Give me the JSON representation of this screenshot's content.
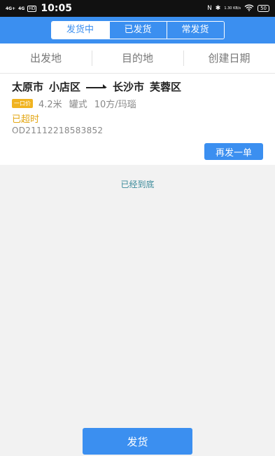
{
  "status_bar": {
    "signal1": "4G+",
    "signal2": "4G",
    "hd": "HD",
    "time": "10:05",
    "nfc": "N",
    "bluetooth": "✱",
    "speed": "1.30 KB/s",
    "wifi": "wifi-icon",
    "battery": "50"
  },
  "header": {
    "tabs": [
      {
        "label": "发货中",
        "active": true
      },
      {
        "label": "已发货",
        "active": false
      },
      {
        "label": "常发货",
        "active": false
      }
    ]
  },
  "filters": [
    {
      "label": "出发地"
    },
    {
      "label": "目的地"
    },
    {
      "label": "创建日期"
    }
  ],
  "order": {
    "origin_city": "太原市",
    "origin_district": "小店区",
    "dest_city": "长沙市",
    "dest_district": "芙蓉区",
    "price_badge": "一口价",
    "length": "4.2米",
    "body_type": "罐式",
    "volume": "10方/玛瑙",
    "status": "已超时",
    "order_no": "OD21112218583852",
    "resend_label": "再发一单"
  },
  "list_end_text": "已经到底",
  "ship_button_label": "发货",
  "colors": {
    "primary": "#3b8ff0",
    "warning": "#e3a612",
    "badge": "#f0b320"
  }
}
